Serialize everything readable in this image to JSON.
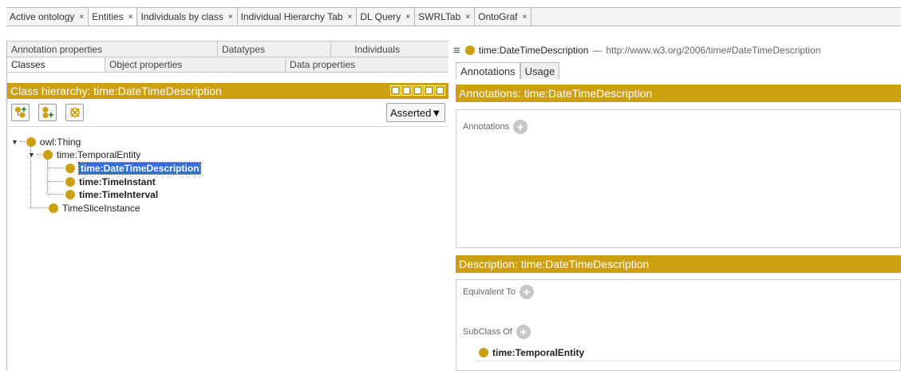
{
  "top_tabs": [
    {
      "label": "Active ontology",
      "close": "×"
    },
    {
      "label": "Entities",
      "close": "×"
    },
    {
      "label": "Individuals by class",
      "close": "×"
    },
    {
      "label": "Individual Hierarchy Tab",
      "close": "×"
    },
    {
      "label": "DL Query",
      "close": "×"
    },
    {
      "label": "SWRLTab",
      "close": "×"
    },
    {
      "label": "OntoGraf",
      "close": "×"
    }
  ],
  "left_tabs_row1": [
    "Annotation properties",
    "Datatypes",
    "Individuals"
  ],
  "left_tabs_row2": [
    "Classes",
    "Object properties",
    "Data properties"
  ],
  "class_hierarchy": {
    "title": "Class hierarchy: time:DateTimeDescription",
    "mode": "Asserted",
    "tree": {
      "root": "owl:Thing",
      "temporal": "time:TemporalEntity",
      "dtd": "time:DateTimeDescription",
      "instant": "time:TimeInstant",
      "interval": "time:TimeInterval",
      "slice": "TimeSliceInstance"
    }
  },
  "entity": {
    "name": "time:DateTimeDescription",
    "separator": "—",
    "iri": "http://www.w3.org/2006/time#DateTimeDescription"
  },
  "right_tabs": [
    "Annotations",
    "Usage"
  ],
  "annotations": {
    "header": "Annotations: time:DateTimeDescription",
    "label": "Annotations"
  },
  "description": {
    "header": "Description: time:DateTimeDescription",
    "equivalent_label": "Equivalent To",
    "subclass_label": "SubClass Of",
    "subclass_item": "time:TemporalEntity"
  },
  "colors": {
    "accent": "#cca010",
    "selection": "#2f6fd6"
  }
}
